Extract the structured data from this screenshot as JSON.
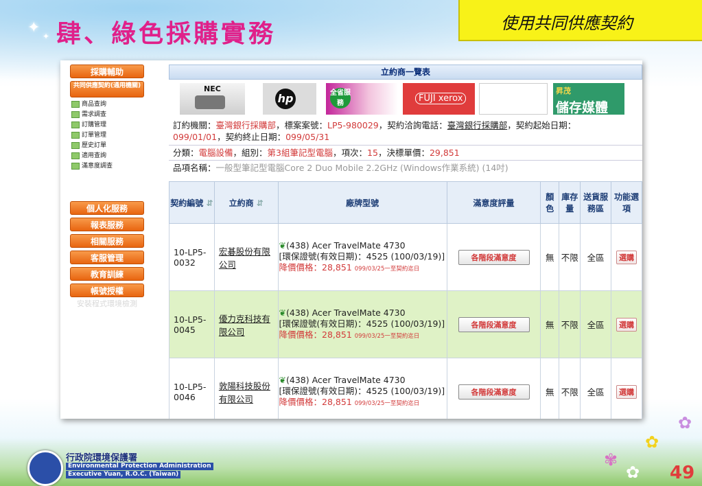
{
  "slide": {
    "title": "肆、綠色採購實務",
    "tag": "使用共同供應契約",
    "page_number": "49",
    "org_name": "行政院環境保護署",
    "org_en_1": "Environmental Protection Administration",
    "org_en_2": "Executive Yuan, R.O.C. (Taiwan)"
  },
  "sidebar": {
    "top_button": "採購輔助",
    "second_button": "共同供應契約(通用機關)",
    "sub_items": [
      "商品查詢",
      "需求調查",
      "訂購管理",
      "訂單管理",
      "歷史訂單",
      "適用查詢",
      "滿意度調查"
    ],
    "buttons": [
      "個人化服務",
      "報表服務",
      "相關服務",
      "客服管理",
      "教育訓練",
      "帳號授權"
    ],
    "link": "安裝程式環境檢測"
  },
  "panel": {
    "header": "立約商一覽表",
    "logos": {
      "nec": "NEC",
      "hp": "hp",
      "service": "全省服務",
      "fujixerox": "FUJI xerox",
      "storage_1": "昇茂",
      "storage_2": "儲存媒體"
    },
    "org_label": "訂約機關：",
    "org_value": "臺灣銀行採購部",
    "case_label": "，標案案號：",
    "case_value": "LP5-980029",
    "phone_label": "，契約洽詢電話：",
    "phone_value": "臺灣銀行採購部",
    "start_label": "，契約起始日期：",
    "start_value": "099/01/01",
    "end_label": "，契約終止日期：",
    "end_value": "099/05/31",
    "cat_label": "分類：",
    "cat_value": "電腦設備",
    "group_label": "，組別：",
    "group_value": "第3組筆記型電腦",
    "item_label": "，項次：",
    "item_value": "15",
    "price_label": "，決標單價：",
    "price_value": "29,851",
    "product_label": "品項名稱：",
    "product_value": "一般型筆記型電腦Core 2 Duo Mobile 2.2GHz (Windows作業系統) (14吋)"
  },
  "table": {
    "headers": {
      "contract_no": "契約編號",
      "vendor": "立約商",
      "model": "廠牌型號",
      "satisfaction": "滿意度評量",
      "color": "顏色",
      "stock": "庫存量",
      "delivery": "送貨服務區",
      "function": "功能選項"
    },
    "rows": [
      {
        "no": "10-LP5-0032",
        "vendor": "宏碁股份有限公司",
        "model": "(438) Acer TravelMate 4730",
        "cert": "[環保證號(有效日期)：4525 (100/03/19)]",
        "discount": "降價價格：28,851",
        "discount_note": "099/03/25一至契約迄日",
        "satisfaction": "各階段滿意度",
        "color": "無",
        "stock": "不限",
        "area": "全區",
        "action": "選購"
      },
      {
        "no": "10-LP5-0045",
        "vendor": "優力克科技有限公司",
        "model": "(438) Acer TravelMate 4730",
        "cert": "[環保證號(有效日期)：4525 (100/03/19)]",
        "discount": "降價價格：28,851",
        "discount_note": "099/03/25一至契約迄日",
        "satisfaction": "各階段滿意度",
        "color": "無",
        "stock": "不限",
        "area": "全區",
        "action": "選購"
      },
      {
        "no": "10-LP5-0046",
        "vendor": "敦陽科技股份有限公司",
        "model": "(438) Acer TravelMate 4730",
        "cert": "[環保證號(有效日期)：4525 (100/03/19)]",
        "discount": "降價價格：28,851",
        "discount_note": "099/03/25一至契約迄日",
        "satisfaction": "各階段滿意度",
        "color": "無",
        "stock": "不限",
        "area": "全區",
        "action": "選購"
      }
    ]
  },
  "colors": {
    "title": "#e0208a",
    "tag_bg": "#f8f218",
    "sidebar_button": "#e86510",
    "alt_row": "#dff2c6",
    "accent_red": "#d23a3a"
  }
}
